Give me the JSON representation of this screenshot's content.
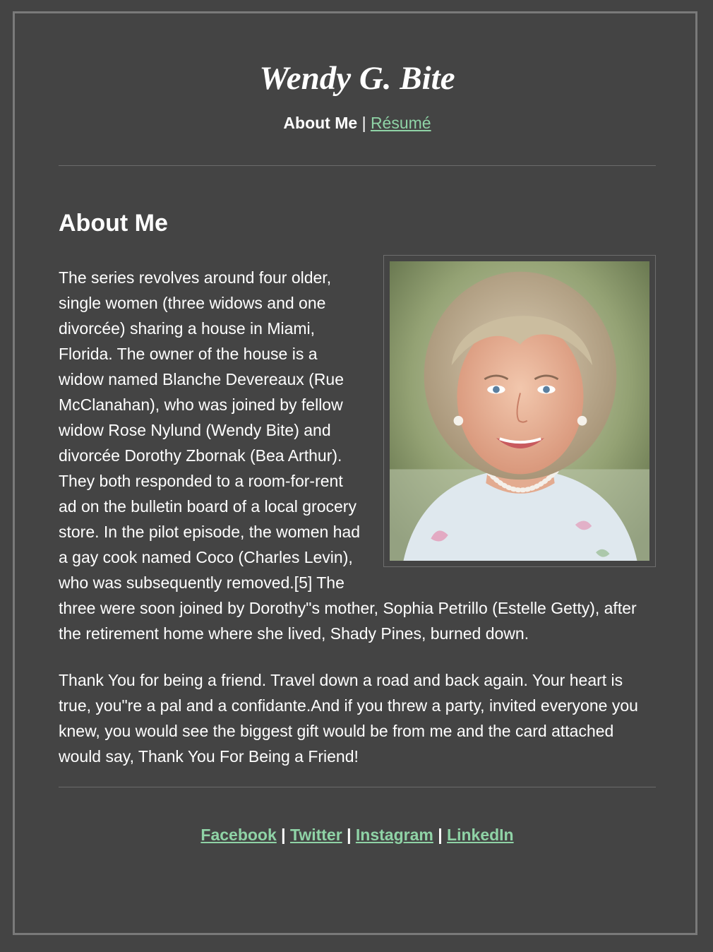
{
  "header": {
    "title": "Wendy G. Bite",
    "nav": {
      "current": "About Me",
      "separator": "|",
      "resume_link": "Résumé"
    }
  },
  "main": {
    "heading": "About Me",
    "photo_icon": "portrait-photo",
    "paragraphs": [
      "The series revolves around four older, single women (three widows and one divorcée) sharing a house in Miami, Florida. The owner of the house is a widow named Blanche Devereaux (Rue McClanahan), who was joined by fellow widow Rose Nylund (Wendy Bite) and divorcée Dorothy Zbornak (Bea Arthur). They both responded to a room-for-rent ad on the bulletin board of a local grocery store. In the pilot episode, the women had a gay cook named Coco (Charles Levin), who was subsequently removed.[5] The three were soon joined by Dorothy\"s mother, Sophia Petrillo (Estelle Getty), after the retirement home where she lived, Shady Pines, burned down.",
      "Thank You for being a friend. Travel down a road and back again. Your heart is true, you\"re a pal and a confidante.And if you threw a party, invited everyone you knew, you would see the biggest gift would be from me and the card attached would say, Thank You For Being a Friend!"
    ]
  },
  "footer": {
    "links": [
      "Facebook",
      "Twitter",
      "Instagram",
      "LinkedIn"
    ],
    "separator": "|"
  },
  "colors": {
    "background": "#444444",
    "link": "#8fd3a6",
    "text": "#ffffff",
    "border": "#7a7a7a"
  }
}
